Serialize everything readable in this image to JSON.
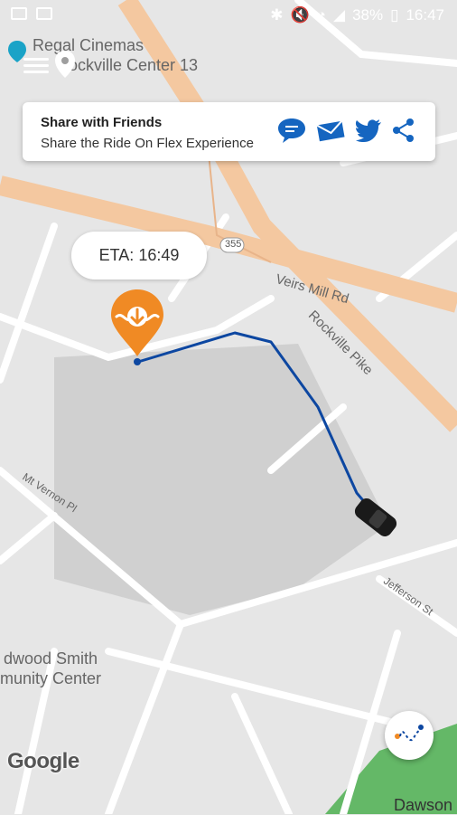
{
  "status_bar": {
    "battery": "38%",
    "time": "16:47"
  },
  "map": {
    "poi_label_line1": "Regal Cinemas",
    "poi_label_line2": "ockville Center 13",
    "road_label_veirs": "Veirs Mill Rd",
    "road_label_rockville": "Rockville Pike",
    "road_label_mt_vernon": "Mt Vernon Pl",
    "road_label_jefferson": "Jefferson St",
    "road_label_route": "355",
    "poi_community_line1": "dwood Smith",
    "poi_community_line2": "munity Center",
    "poi_dawson": "Dawson",
    "google_logo": "Google"
  },
  "share_card": {
    "title": "Share with Friends",
    "subtitle": "Share the Ride On Flex Experience",
    "icons": [
      "sms-icon",
      "email-icon",
      "twitter-icon",
      "share-icon"
    ],
    "icon_color": "#1565c0"
  },
  "eta": {
    "label": "ETA: 16:49"
  },
  "colors": {
    "pin": "#f08a24",
    "route": "#0d47a1",
    "major_road": "#f4c8a0",
    "park": "#4caf50"
  }
}
